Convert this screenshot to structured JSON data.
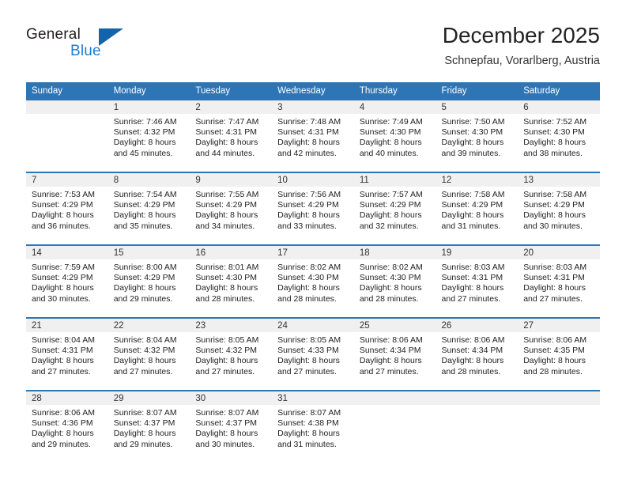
{
  "logo": {
    "text_top": "General",
    "text_bottom": "Blue",
    "triangle_color": "#1464ab",
    "blue_color": "#1b7fd4"
  },
  "header": {
    "title": "December 2025",
    "subtitle": "Schnepfau, Vorarlberg, Austria"
  },
  "theme": {
    "accent": "#2e75b6",
    "header_text": "#ffffff",
    "daynum_band": "#f0f0f0",
    "body_text": "#222222"
  },
  "calendar": {
    "weekday_headers": [
      "Sunday",
      "Monday",
      "Tuesday",
      "Wednesday",
      "Thursday",
      "Friday",
      "Saturday"
    ],
    "weeks": [
      [
        {
          "day": "",
          "sunrise": "",
          "sunset": "",
          "daylight_line1": "",
          "daylight_line2": ""
        },
        {
          "day": "1",
          "sunrise": "Sunrise: 7:46 AM",
          "sunset": "Sunset: 4:32 PM",
          "daylight_line1": "Daylight: 8 hours",
          "daylight_line2": "and 45 minutes."
        },
        {
          "day": "2",
          "sunrise": "Sunrise: 7:47 AM",
          "sunset": "Sunset: 4:31 PM",
          "daylight_line1": "Daylight: 8 hours",
          "daylight_line2": "and 44 minutes."
        },
        {
          "day": "3",
          "sunrise": "Sunrise: 7:48 AM",
          "sunset": "Sunset: 4:31 PM",
          "daylight_line1": "Daylight: 8 hours",
          "daylight_line2": "and 42 minutes."
        },
        {
          "day": "4",
          "sunrise": "Sunrise: 7:49 AM",
          "sunset": "Sunset: 4:30 PM",
          "daylight_line1": "Daylight: 8 hours",
          "daylight_line2": "and 40 minutes."
        },
        {
          "day": "5",
          "sunrise": "Sunrise: 7:50 AM",
          "sunset": "Sunset: 4:30 PM",
          "daylight_line1": "Daylight: 8 hours",
          "daylight_line2": "and 39 minutes."
        },
        {
          "day": "6",
          "sunrise": "Sunrise: 7:52 AM",
          "sunset": "Sunset: 4:30 PM",
          "daylight_line1": "Daylight: 8 hours",
          "daylight_line2": "and 38 minutes."
        }
      ],
      [
        {
          "day": "7",
          "sunrise": "Sunrise: 7:53 AM",
          "sunset": "Sunset: 4:29 PM",
          "daylight_line1": "Daylight: 8 hours",
          "daylight_line2": "and 36 minutes."
        },
        {
          "day": "8",
          "sunrise": "Sunrise: 7:54 AM",
          "sunset": "Sunset: 4:29 PM",
          "daylight_line1": "Daylight: 8 hours",
          "daylight_line2": "and 35 minutes."
        },
        {
          "day": "9",
          "sunrise": "Sunrise: 7:55 AM",
          "sunset": "Sunset: 4:29 PM",
          "daylight_line1": "Daylight: 8 hours",
          "daylight_line2": "and 34 minutes."
        },
        {
          "day": "10",
          "sunrise": "Sunrise: 7:56 AM",
          "sunset": "Sunset: 4:29 PM",
          "daylight_line1": "Daylight: 8 hours",
          "daylight_line2": "and 33 minutes."
        },
        {
          "day": "11",
          "sunrise": "Sunrise: 7:57 AM",
          "sunset": "Sunset: 4:29 PM",
          "daylight_line1": "Daylight: 8 hours",
          "daylight_line2": "and 32 minutes."
        },
        {
          "day": "12",
          "sunrise": "Sunrise: 7:58 AM",
          "sunset": "Sunset: 4:29 PM",
          "daylight_line1": "Daylight: 8 hours",
          "daylight_line2": "and 31 minutes."
        },
        {
          "day": "13",
          "sunrise": "Sunrise: 7:58 AM",
          "sunset": "Sunset: 4:29 PM",
          "daylight_line1": "Daylight: 8 hours",
          "daylight_line2": "and 30 minutes."
        }
      ],
      [
        {
          "day": "14",
          "sunrise": "Sunrise: 7:59 AM",
          "sunset": "Sunset: 4:29 PM",
          "daylight_line1": "Daylight: 8 hours",
          "daylight_line2": "and 30 minutes."
        },
        {
          "day": "15",
          "sunrise": "Sunrise: 8:00 AM",
          "sunset": "Sunset: 4:29 PM",
          "daylight_line1": "Daylight: 8 hours",
          "daylight_line2": "and 29 minutes."
        },
        {
          "day": "16",
          "sunrise": "Sunrise: 8:01 AM",
          "sunset": "Sunset: 4:30 PM",
          "daylight_line1": "Daylight: 8 hours",
          "daylight_line2": "and 28 minutes."
        },
        {
          "day": "17",
          "sunrise": "Sunrise: 8:02 AM",
          "sunset": "Sunset: 4:30 PM",
          "daylight_line1": "Daylight: 8 hours",
          "daylight_line2": "and 28 minutes."
        },
        {
          "day": "18",
          "sunrise": "Sunrise: 8:02 AM",
          "sunset": "Sunset: 4:30 PM",
          "daylight_line1": "Daylight: 8 hours",
          "daylight_line2": "and 28 minutes."
        },
        {
          "day": "19",
          "sunrise": "Sunrise: 8:03 AM",
          "sunset": "Sunset: 4:31 PM",
          "daylight_line1": "Daylight: 8 hours",
          "daylight_line2": "and 27 minutes."
        },
        {
          "day": "20",
          "sunrise": "Sunrise: 8:03 AM",
          "sunset": "Sunset: 4:31 PM",
          "daylight_line1": "Daylight: 8 hours",
          "daylight_line2": "and 27 minutes."
        }
      ],
      [
        {
          "day": "21",
          "sunrise": "Sunrise: 8:04 AM",
          "sunset": "Sunset: 4:31 PM",
          "daylight_line1": "Daylight: 8 hours",
          "daylight_line2": "and 27 minutes."
        },
        {
          "day": "22",
          "sunrise": "Sunrise: 8:04 AM",
          "sunset": "Sunset: 4:32 PM",
          "daylight_line1": "Daylight: 8 hours",
          "daylight_line2": "and 27 minutes."
        },
        {
          "day": "23",
          "sunrise": "Sunrise: 8:05 AM",
          "sunset": "Sunset: 4:32 PM",
          "daylight_line1": "Daylight: 8 hours",
          "daylight_line2": "and 27 minutes."
        },
        {
          "day": "24",
          "sunrise": "Sunrise: 8:05 AM",
          "sunset": "Sunset: 4:33 PM",
          "daylight_line1": "Daylight: 8 hours",
          "daylight_line2": "and 27 minutes."
        },
        {
          "day": "25",
          "sunrise": "Sunrise: 8:06 AM",
          "sunset": "Sunset: 4:34 PM",
          "daylight_line1": "Daylight: 8 hours",
          "daylight_line2": "and 27 minutes."
        },
        {
          "day": "26",
          "sunrise": "Sunrise: 8:06 AM",
          "sunset": "Sunset: 4:34 PM",
          "daylight_line1": "Daylight: 8 hours",
          "daylight_line2": "and 28 minutes."
        },
        {
          "day": "27",
          "sunrise": "Sunrise: 8:06 AM",
          "sunset": "Sunset: 4:35 PM",
          "daylight_line1": "Daylight: 8 hours",
          "daylight_line2": "and 28 minutes."
        }
      ],
      [
        {
          "day": "28",
          "sunrise": "Sunrise: 8:06 AM",
          "sunset": "Sunset: 4:36 PM",
          "daylight_line1": "Daylight: 8 hours",
          "daylight_line2": "and 29 minutes."
        },
        {
          "day": "29",
          "sunrise": "Sunrise: 8:07 AM",
          "sunset": "Sunset: 4:37 PM",
          "daylight_line1": "Daylight: 8 hours",
          "daylight_line2": "and 29 minutes."
        },
        {
          "day": "30",
          "sunrise": "Sunrise: 8:07 AM",
          "sunset": "Sunset: 4:37 PM",
          "daylight_line1": "Daylight: 8 hours",
          "daylight_line2": "and 30 minutes."
        },
        {
          "day": "31",
          "sunrise": "Sunrise: 8:07 AM",
          "sunset": "Sunset: 4:38 PM",
          "daylight_line1": "Daylight: 8 hours",
          "daylight_line2": "and 31 minutes."
        },
        {
          "day": "",
          "sunrise": "",
          "sunset": "",
          "daylight_line1": "",
          "daylight_line2": ""
        },
        {
          "day": "",
          "sunrise": "",
          "sunset": "",
          "daylight_line1": "",
          "daylight_line2": ""
        },
        {
          "day": "",
          "sunrise": "",
          "sunset": "",
          "daylight_line1": "",
          "daylight_line2": ""
        }
      ]
    ]
  }
}
